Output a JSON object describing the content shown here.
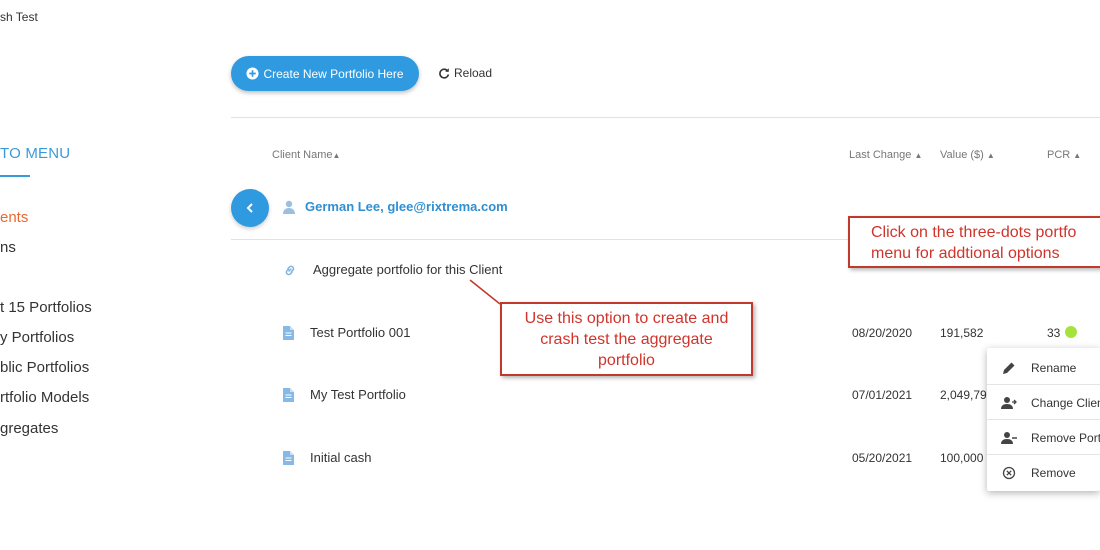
{
  "app": {
    "title_fragment": "sh Test"
  },
  "sidebar": {
    "back_label": "TO MENU",
    "items": [
      {
        "label": "ents",
        "active": true
      },
      {
        "label": "ns",
        "active": false
      },
      {
        "label": "t 15 Portfolios",
        "active": false
      },
      {
        "label": "y Portfolios",
        "active": false
      },
      {
        "label": "blic Portfolios",
        "active": false
      },
      {
        "label": "rtfolio Models",
        "active": false
      },
      {
        "label": "gregates",
        "active": false
      }
    ]
  },
  "toolbar": {
    "create_label": "Create New Portfolio Here",
    "reload_label": "Reload"
  },
  "table": {
    "headers": {
      "client_name": "Client Name",
      "last_change": "Last Change",
      "value": "Value ($)",
      "pcr": "PCR"
    },
    "client": "German Lee, glee@rixtrema.com",
    "aggregate_label": "Aggregate portfolio for this Client",
    "rows": [
      {
        "name": "Test Portfolio 001",
        "last_change": "08/20/2020",
        "value": "191,582",
        "pcr": "33"
      },
      {
        "name": "My Test Portfolio",
        "last_change": "07/01/2021",
        "value": "2,049,79",
        "pcr": ""
      },
      {
        "name": "Initial cash",
        "last_change": "05/20/2021",
        "value": "100,000",
        "pcr": ""
      }
    ]
  },
  "context_menu": {
    "items": [
      {
        "label": "Rename",
        "icon": "pencil-icon"
      },
      {
        "label": "Change Clien",
        "icon": "user-swap-icon"
      },
      {
        "label": "Remove Port",
        "icon": "user-minus-icon"
      },
      {
        "label": "Remove",
        "icon": "remove-circle-icon"
      }
    ]
  },
  "callouts": {
    "three_dots": "Click on the three-dots portfo\nmenu for addtional options",
    "aggregate": "Use this option to create and\ncrash test the aggregate\nportfolio"
  },
  "colors": {
    "accent": "#2f9ae0",
    "active_nav": "#e86a30",
    "callout": "#c0392b",
    "pcr_good": "#a6e33a"
  }
}
